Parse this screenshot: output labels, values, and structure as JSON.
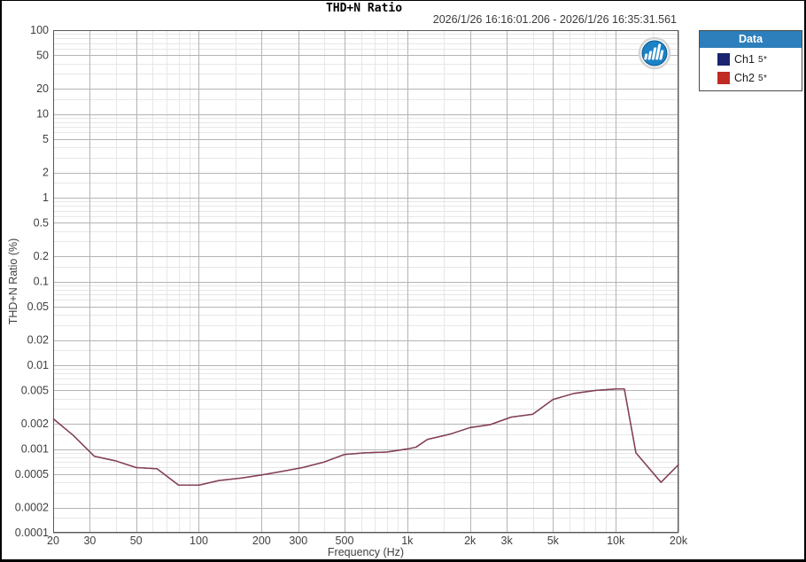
{
  "header": {
    "title": "THD+N Ratio",
    "time_range": "2026/1/26 16:16:01.206 - 2026/1/26 16:35:31.561"
  },
  "legend": {
    "title": "Data",
    "header_bg": "#2d7fbb",
    "border_color": "#4a4a4a",
    "items": [
      {
        "name": "Ch1",
        "suffix": "5*",
        "color": "#1a2470"
      },
      {
        "name": "Ch2",
        "suffix": "5*",
        "color": "#c02b24"
      }
    ]
  },
  "logo": {
    "name": "audio-analyzer-logo",
    "circle_color": "#1b82c6",
    "ring_color": "#d4d4d4",
    "bar_color": "#ffffff"
  },
  "chart_data": {
    "type": "line",
    "title": "THD+N Ratio",
    "xlabel": "Frequency (Hz)",
    "ylabel": "THD+N Ratio (%)",
    "x_scale": "log",
    "y_scale": "log",
    "xlim": [
      20,
      20000
    ],
    "ylim": [
      0.0001,
      100
    ],
    "grid": true,
    "legend_position": "outside-top-right",
    "x_tick_values": [
      20,
      30,
      50,
      100,
      200,
      300,
      500,
      1000,
      2000,
      3000,
      5000,
      10000,
      20000
    ],
    "x_tick_labels": [
      "20",
      "30",
      "50",
      "100",
      "200",
      "300",
      "500",
      "1k",
      "2k",
      "3k",
      "5k",
      "10k",
      "20k"
    ],
    "y_tick_values": [
      100,
      50,
      20,
      10,
      5,
      2,
      1,
      0.5,
      0.2,
      0.1,
      0.05,
      0.02,
      0.01,
      0.005,
      0.002,
      0.001,
      0.0005,
      0.0002,
      0.0001
    ],
    "y_tick_labels": [
      "100",
      "50",
      "20",
      "10",
      "5",
      "2",
      "1",
      "0.5",
      "0.2",
      "0.1",
      "0.05",
      "0.02",
      "0.01",
      "0.005",
      "0.002",
      "0.001",
      "0.0005",
      "0.0002",
      "0.0001"
    ],
    "grid_major_color": "#b4b4b4",
    "grid_minor_color": "#e7e7e7",
    "plot_border_color": "#5a5a5a",
    "label_color": "#3f3f3f",
    "x": [
      20,
      25,
      31.5,
      40,
      50,
      63,
      80,
      100,
      125,
      160,
      200,
      250,
      315,
      400,
      500,
      630,
      800,
      1000,
      1100,
      1250,
      1600,
      2000,
      2500,
      3150,
      4000,
      5000,
      6300,
      8000,
      10000,
      11000,
      12500,
      16500,
      20000
    ],
    "series": [
      {
        "name": "Ch1 5*",
        "legend_color": "#1a2470",
        "line_color": "#1a2470",
        "y": [
          0.0023,
          0.00145,
          0.00082,
          0.00072,
          0.0006,
          0.00058,
          0.00037,
          0.00037,
          0.00042,
          0.00045,
          0.00049,
          0.00054,
          0.0006,
          0.0007,
          0.00086,
          0.0009,
          0.00092,
          0.001,
          0.00105,
          0.0013,
          0.0015,
          0.0018,
          0.00195,
          0.0024,
          0.0026,
          0.0039,
          0.0046,
          0.005,
          0.0052,
          0.0052,
          0.0009,
          0.0004,
          0.00065
        ]
      },
      {
        "name": "Ch2 5*",
        "legend_color": "#c02b24",
        "line_color": "#8c4150",
        "y": [
          0.0023,
          0.00145,
          0.00082,
          0.00072,
          0.0006,
          0.00058,
          0.00037,
          0.00037,
          0.00042,
          0.00045,
          0.00049,
          0.00054,
          0.0006,
          0.0007,
          0.00086,
          0.0009,
          0.00092,
          0.001,
          0.00105,
          0.0013,
          0.0015,
          0.0018,
          0.00195,
          0.0024,
          0.0026,
          0.0039,
          0.0046,
          0.005,
          0.0052,
          0.0052,
          0.0009,
          0.0004,
          0.00065
        ]
      }
    ]
  }
}
